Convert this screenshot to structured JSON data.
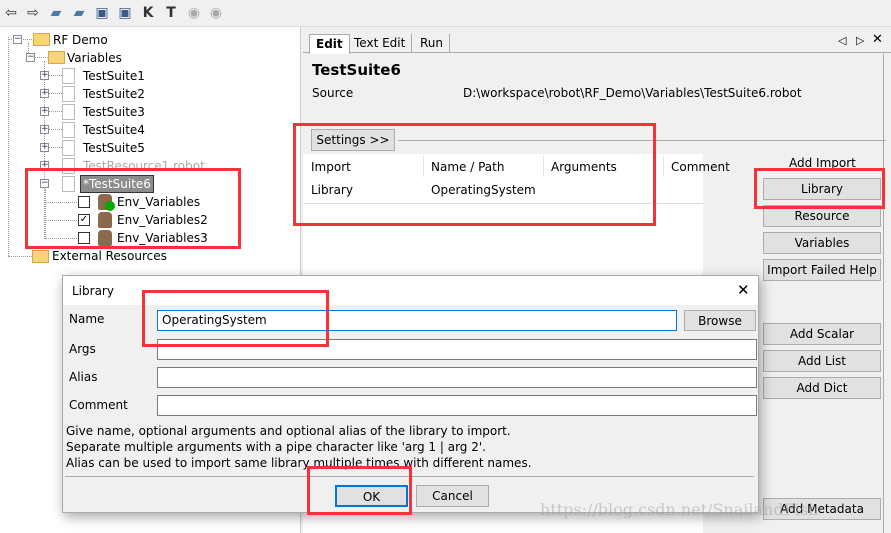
{
  "toolbar": {
    "icons": [
      "arrow-left-icon",
      "arrow-right-icon",
      "open-folder-icon",
      "folder-icon",
      "save-icon",
      "save-all-icon",
      "search-keyword-icon",
      "search-test-icon",
      "run-icon",
      "stop-icon"
    ]
  },
  "tree": {
    "root": "RF Demo",
    "folder": "Variables",
    "suites": [
      "TestSuite1",
      "TestSuite2",
      "TestSuite3",
      "TestSuite4",
      "TestSuite5"
    ],
    "resource": "TestResource1.robot",
    "selected": "*TestSuite6",
    "children": [
      {
        "label": "Env_Variables",
        "checked": false
      },
      {
        "label": "Env_Variables2",
        "checked": true
      },
      {
        "label": "Env_Variables3",
        "checked": false
      }
    ],
    "external": "External Resources"
  },
  "editor": {
    "tabs": [
      "Edit",
      "Text Edit",
      "Run"
    ],
    "title": "TestSuite6",
    "source_label": "Source",
    "source_path": "D:\\workspace\\robot\\RF_Demo\\Variables\\TestSuite6.robot",
    "settings_button": "Settings >>",
    "columns": [
      "Import",
      "Name / Path",
      "Arguments",
      "Comment"
    ],
    "rows": [
      [
        "Library",
        "OperatingSystem",
        "",
        ""
      ]
    ],
    "add_import_label": "Add Import",
    "import_buttons": [
      "Library",
      "Resource",
      "Variables",
      "Import Failed Help"
    ],
    "variable_buttons": [
      "Add Scalar",
      "Add List",
      "Add Dict"
    ],
    "metadata_button": "Add Metadata"
  },
  "dialog": {
    "title": "Library",
    "name_label": "Name",
    "name_value": "OperatingSystem",
    "args_label": "Args",
    "args_value": "",
    "alias_label": "Alias",
    "alias_value": "",
    "comment_label": "Comment",
    "comment_value": "",
    "browse": "Browse",
    "help": [
      "Give name, optional arguments and optional alias of the library to import.",
      "Separate multiple arguments with a pipe character like 'arg 1 | arg 2'.",
      "Alias can be used to import same library multiple times with different names."
    ],
    "ok": "OK",
    "cancel": "Cancel"
  },
  "watermark": "https://blog.csdn.net/SnailandFish",
  "colors": {
    "highlight": "#f0343a",
    "focus": "#0078d7"
  }
}
